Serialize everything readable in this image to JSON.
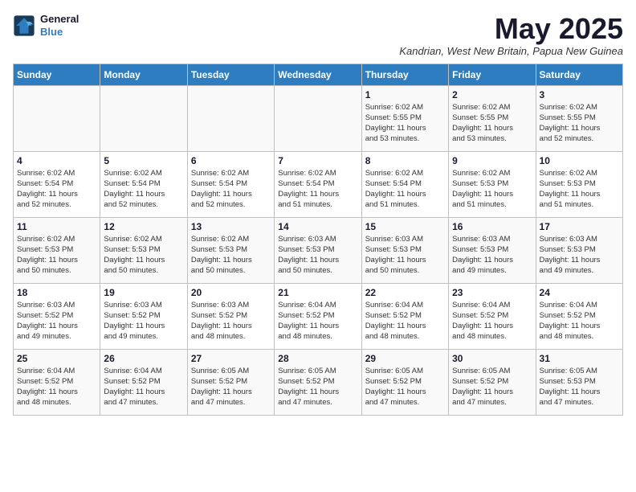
{
  "logo": {
    "general": "General",
    "blue": "Blue"
  },
  "title": "May 2025",
  "location": "Kandrian, West New Britain, Papua New Guinea",
  "days_of_week": [
    "Sunday",
    "Monday",
    "Tuesday",
    "Wednesday",
    "Thursday",
    "Friday",
    "Saturday"
  ],
  "weeks": [
    [
      {
        "day": "",
        "info": ""
      },
      {
        "day": "",
        "info": ""
      },
      {
        "day": "",
        "info": ""
      },
      {
        "day": "",
        "info": ""
      },
      {
        "day": "1",
        "info": "Sunrise: 6:02 AM\nSunset: 5:55 PM\nDaylight: 11 hours\nand 53 minutes."
      },
      {
        "day": "2",
        "info": "Sunrise: 6:02 AM\nSunset: 5:55 PM\nDaylight: 11 hours\nand 53 minutes."
      },
      {
        "day": "3",
        "info": "Sunrise: 6:02 AM\nSunset: 5:55 PM\nDaylight: 11 hours\nand 52 minutes."
      }
    ],
    [
      {
        "day": "4",
        "info": "Sunrise: 6:02 AM\nSunset: 5:54 PM\nDaylight: 11 hours\nand 52 minutes."
      },
      {
        "day": "5",
        "info": "Sunrise: 6:02 AM\nSunset: 5:54 PM\nDaylight: 11 hours\nand 52 minutes."
      },
      {
        "day": "6",
        "info": "Sunrise: 6:02 AM\nSunset: 5:54 PM\nDaylight: 11 hours\nand 52 minutes."
      },
      {
        "day": "7",
        "info": "Sunrise: 6:02 AM\nSunset: 5:54 PM\nDaylight: 11 hours\nand 51 minutes."
      },
      {
        "day": "8",
        "info": "Sunrise: 6:02 AM\nSunset: 5:54 PM\nDaylight: 11 hours\nand 51 minutes."
      },
      {
        "day": "9",
        "info": "Sunrise: 6:02 AM\nSunset: 5:53 PM\nDaylight: 11 hours\nand 51 minutes."
      },
      {
        "day": "10",
        "info": "Sunrise: 6:02 AM\nSunset: 5:53 PM\nDaylight: 11 hours\nand 51 minutes."
      }
    ],
    [
      {
        "day": "11",
        "info": "Sunrise: 6:02 AM\nSunset: 5:53 PM\nDaylight: 11 hours\nand 50 minutes."
      },
      {
        "day": "12",
        "info": "Sunrise: 6:02 AM\nSunset: 5:53 PM\nDaylight: 11 hours\nand 50 minutes."
      },
      {
        "day": "13",
        "info": "Sunrise: 6:02 AM\nSunset: 5:53 PM\nDaylight: 11 hours\nand 50 minutes."
      },
      {
        "day": "14",
        "info": "Sunrise: 6:03 AM\nSunset: 5:53 PM\nDaylight: 11 hours\nand 50 minutes."
      },
      {
        "day": "15",
        "info": "Sunrise: 6:03 AM\nSunset: 5:53 PM\nDaylight: 11 hours\nand 50 minutes."
      },
      {
        "day": "16",
        "info": "Sunrise: 6:03 AM\nSunset: 5:53 PM\nDaylight: 11 hours\nand 49 minutes."
      },
      {
        "day": "17",
        "info": "Sunrise: 6:03 AM\nSunset: 5:53 PM\nDaylight: 11 hours\nand 49 minutes."
      }
    ],
    [
      {
        "day": "18",
        "info": "Sunrise: 6:03 AM\nSunset: 5:52 PM\nDaylight: 11 hours\nand 49 minutes."
      },
      {
        "day": "19",
        "info": "Sunrise: 6:03 AM\nSunset: 5:52 PM\nDaylight: 11 hours\nand 49 minutes."
      },
      {
        "day": "20",
        "info": "Sunrise: 6:03 AM\nSunset: 5:52 PM\nDaylight: 11 hours\nand 48 minutes."
      },
      {
        "day": "21",
        "info": "Sunrise: 6:04 AM\nSunset: 5:52 PM\nDaylight: 11 hours\nand 48 minutes."
      },
      {
        "day": "22",
        "info": "Sunrise: 6:04 AM\nSunset: 5:52 PM\nDaylight: 11 hours\nand 48 minutes."
      },
      {
        "day": "23",
        "info": "Sunrise: 6:04 AM\nSunset: 5:52 PM\nDaylight: 11 hours\nand 48 minutes."
      },
      {
        "day": "24",
        "info": "Sunrise: 6:04 AM\nSunset: 5:52 PM\nDaylight: 11 hours\nand 48 minutes."
      }
    ],
    [
      {
        "day": "25",
        "info": "Sunrise: 6:04 AM\nSunset: 5:52 PM\nDaylight: 11 hours\nand 48 minutes."
      },
      {
        "day": "26",
        "info": "Sunrise: 6:04 AM\nSunset: 5:52 PM\nDaylight: 11 hours\nand 47 minutes."
      },
      {
        "day": "27",
        "info": "Sunrise: 6:05 AM\nSunset: 5:52 PM\nDaylight: 11 hours\nand 47 minutes."
      },
      {
        "day": "28",
        "info": "Sunrise: 6:05 AM\nSunset: 5:52 PM\nDaylight: 11 hours\nand 47 minutes."
      },
      {
        "day": "29",
        "info": "Sunrise: 6:05 AM\nSunset: 5:52 PM\nDaylight: 11 hours\nand 47 minutes."
      },
      {
        "day": "30",
        "info": "Sunrise: 6:05 AM\nSunset: 5:52 PM\nDaylight: 11 hours\nand 47 minutes."
      },
      {
        "day": "31",
        "info": "Sunrise: 6:05 AM\nSunset: 5:53 PM\nDaylight: 11 hours\nand 47 minutes."
      }
    ]
  ]
}
